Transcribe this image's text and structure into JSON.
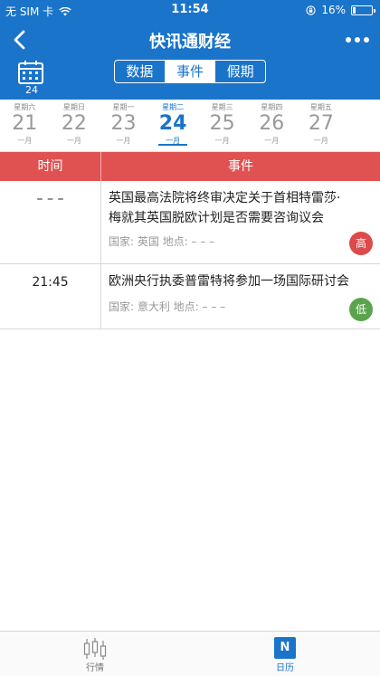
{
  "status": {
    "carrier": "无 SIM 卡",
    "time": "11:54",
    "battery_percent": "16%",
    "battery_level": 0.16
  },
  "nav": {
    "title": "快讯通财经"
  },
  "calendar_icon": {
    "day": "24"
  },
  "segments": [
    {
      "label": "数据",
      "active": false
    },
    {
      "label": "事件",
      "active": true
    },
    {
      "label": "假期",
      "active": false
    }
  ],
  "dates": [
    {
      "weekday": "星期六",
      "day": "21",
      "month": "一月",
      "active": false
    },
    {
      "weekday": "星期日",
      "day": "22",
      "month": "一月",
      "active": false
    },
    {
      "weekday": "星期一",
      "day": "23",
      "month": "一月",
      "active": false
    },
    {
      "weekday": "星期二",
      "day": "24",
      "month": "一月",
      "active": true
    },
    {
      "weekday": "星期三",
      "day": "25",
      "month": "一月",
      "active": false
    },
    {
      "weekday": "星期四",
      "day": "26",
      "month": "一月",
      "active": false
    },
    {
      "weekday": "星期五",
      "day": "27",
      "month": "一月",
      "active": false
    }
  ],
  "table": {
    "headers": {
      "time": "时间",
      "event": "事件"
    },
    "rows": [
      {
        "time": "– – –",
        "event": "英国最高法院将终审决定关于首相特雷莎·梅就其英国脱欧计划是否需要咨询议会",
        "meta": "国家:  英国  地点:  – – –",
        "importance": "高",
        "importance_color": "#dd4a4a"
      },
      {
        "time": "21:45",
        "event": "欧洲央行执委普雷特将参加一场国际研讨会",
        "meta": "国家:  意大利  地点:  – – –",
        "importance": "低",
        "importance_color": "#5aa54c"
      }
    ]
  },
  "tabbar": [
    {
      "label": "行情",
      "icon": "candlestick-icon",
      "active": false
    },
    {
      "label": "日历",
      "icon": "calendar-n-icon",
      "active": true,
      "icon_text": "N"
    }
  ],
  "colors": {
    "brand": "#1a74c9",
    "table_header": "#e05252"
  }
}
